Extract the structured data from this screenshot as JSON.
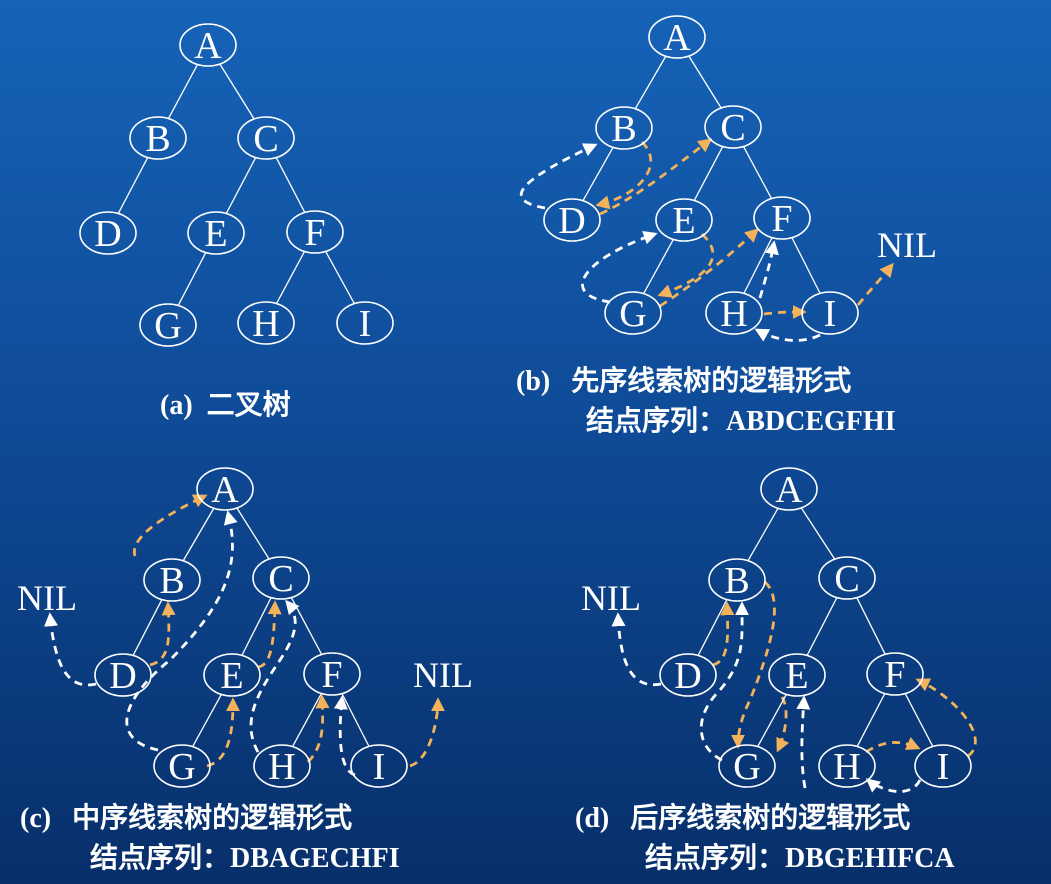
{
  "colors": {
    "thread_white": "#ffffff",
    "thread_orange": "#f4b25a",
    "background": "#1258aa"
  },
  "panels": [
    {
      "id": "a",
      "tag": "(a)",
      "caption_line1": "二叉树",
      "caption_line2_label": "",
      "caption_line2_sequence": "",
      "nodes": [
        {
          "label": "A"
        },
        {
          "label": "B"
        },
        {
          "label": "C"
        },
        {
          "label": "D"
        },
        {
          "label": "E"
        },
        {
          "label": "F"
        },
        {
          "label": "G"
        },
        {
          "label": "H"
        },
        {
          "label": "I"
        }
      ],
      "edges": [
        [
          "A",
          "B"
        ],
        [
          "A",
          "C"
        ],
        [
          "B",
          "D"
        ],
        [
          "C",
          "E"
        ],
        [
          "C",
          "F"
        ],
        [
          "E",
          "G"
        ],
        [
          "F",
          "H"
        ],
        [
          "F",
          "I"
        ]
      ],
      "nil_labels": [],
      "threads": []
    },
    {
      "id": "b",
      "tag": "(b)",
      "caption_line1": "先序线索树的逻辑形式",
      "caption_line2_label": "结点序列：",
      "caption_line2_sequence": "ABDCEGFHI",
      "nodes": [
        {
          "label": "A"
        },
        {
          "label": "B"
        },
        {
          "label": "C"
        },
        {
          "label": "D"
        },
        {
          "label": "E"
        },
        {
          "label": "F"
        },
        {
          "label": "G"
        },
        {
          "label": "H"
        },
        {
          "label": "I"
        }
      ],
      "edges": [
        [
          "A",
          "B"
        ],
        [
          "A",
          "C"
        ],
        [
          "B",
          "D"
        ],
        [
          "C",
          "E"
        ],
        [
          "C",
          "F"
        ],
        [
          "E",
          "G"
        ],
        [
          "F",
          "H"
        ],
        [
          "F",
          "I"
        ]
      ],
      "nil_labels": [
        "NIL"
      ],
      "threads": [
        {
          "from": "D",
          "to": "B",
          "kind": "pred"
        },
        {
          "from": "B",
          "to": "D",
          "kind": "succ"
        },
        {
          "from": "D",
          "to": "C",
          "kind": "succ"
        },
        {
          "from": "G",
          "to": "E",
          "kind": "pred"
        },
        {
          "from": "E",
          "to": "G",
          "kind": "succ"
        },
        {
          "from": "G",
          "to": "F",
          "kind": "succ"
        },
        {
          "from": "H",
          "to": "F",
          "kind": "pred"
        },
        {
          "from": "H",
          "to": "I",
          "kind": "succ"
        },
        {
          "from": "I",
          "to": "H",
          "kind": "pred"
        },
        {
          "from": "I",
          "to": "NIL",
          "kind": "succ"
        }
      ]
    },
    {
      "id": "c",
      "tag": "(c)",
      "caption_line1": "中序线索树的逻辑形式",
      "caption_line2_label": "结点序列：",
      "caption_line2_sequence": "DBAGECHFI",
      "nodes": [
        {
          "label": "A"
        },
        {
          "label": "B"
        },
        {
          "label": "C"
        },
        {
          "label": "D"
        },
        {
          "label": "E"
        },
        {
          "label": "F"
        },
        {
          "label": "G"
        },
        {
          "label": "H"
        },
        {
          "label": "I"
        }
      ],
      "edges": [
        [
          "A",
          "B"
        ],
        [
          "A",
          "C"
        ],
        [
          "B",
          "D"
        ],
        [
          "C",
          "E"
        ],
        [
          "C",
          "F"
        ],
        [
          "E",
          "G"
        ],
        [
          "F",
          "H"
        ],
        [
          "F",
          "I"
        ]
      ],
      "nil_labels": [
        "NIL",
        "NIL"
      ],
      "threads": [
        {
          "from": "D",
          "to": "NIL",
          "kind": "pred"
        },
        {
          "from": "D",
          "to": "B",
          "kind": "succ"
        },
        {
          "from": "B",
          "to": "A",
          "kind": "succ"
        },
        {
          "from": "G",
          "to": "A",
          "kind": "pred"
        },
        {
          "from": "G",
          "to": "E",
          "kind": "succ"
        },
        {
          "from": "E",
          "to": "C",
          "kind": "succ"
        },
        {
          "from": "H",
          "to": "C",
          "kind": "pred"
        },
        {
          "from": "H",
          "to": "F",
          "kind": "succ"
        },
        {
          "from": "I",
          "to": "F",
          "kind": "pred"
        },
        {
          "from": "I",
          "to": "NIL",
          "kind": "succ"
        }
      ]
    },
    {
      "id": "d",
      "tag": "(d)",
      "caption_line1": "后序线索树的逻辑形式",
      "caption_line2_label": "结点序列：",
      "caption_line2_sequence": "DBGEHIFCA",
      "nodes": [
        {
          "label": "A"
        },
        {
          "label": "B"
        },
        {
          "label": "C"
        },
        {
          "label": "D"
        },
        {
          "label": "E"
        },
        {
          "label": "F"
        },
        {
          "label": "G"
        },
        {
          "label": "H"
        },
        {
          "label": "I"
        }
      ],
      "edges": [
        [
          "A",
          "B"
        ],
        [
          "A",
          "C"
        ],
        [
          "B",
          "D"
        ],
        [
          "C",
          "E"
        ],
        [
          "C",
          "F"
        ],
        [
          "E",
          "G"
        ],
        [
          "F",
          "H"
        ],
        [
          "F",
          "I"
        ]
      ],
      "nil_labels": [
        "NIL"
      ],
      "threads": [
        {
          "from": "D",
          "to": "NIL",
          "kind": "pred"
        },
        {
          "from": "D",
          "to": "B",
          "kind": "succ"
        },
        {
          "from": "G",
          "to": "B",
          "kind": "pred"
        },
        {
          "from": "B",
          "to": "G",
          "kind": "succ"
        },
        {
          "from": "E",
          "to": "G",
          "kind": "succ"
        },
        {
          "from": "H",
          "to": "E",
          "kind": "pred"
        },
        {
          "from": "H",
          "to": "I",
          "kind": "succ"
        },
        {
          "from": "I",
          "to": "H",
          "kind": "pred"
        },
        {
          "from": "I",
          "to": "F",
          "kind": "succ"
        }
      ]
    }
  ]
}
